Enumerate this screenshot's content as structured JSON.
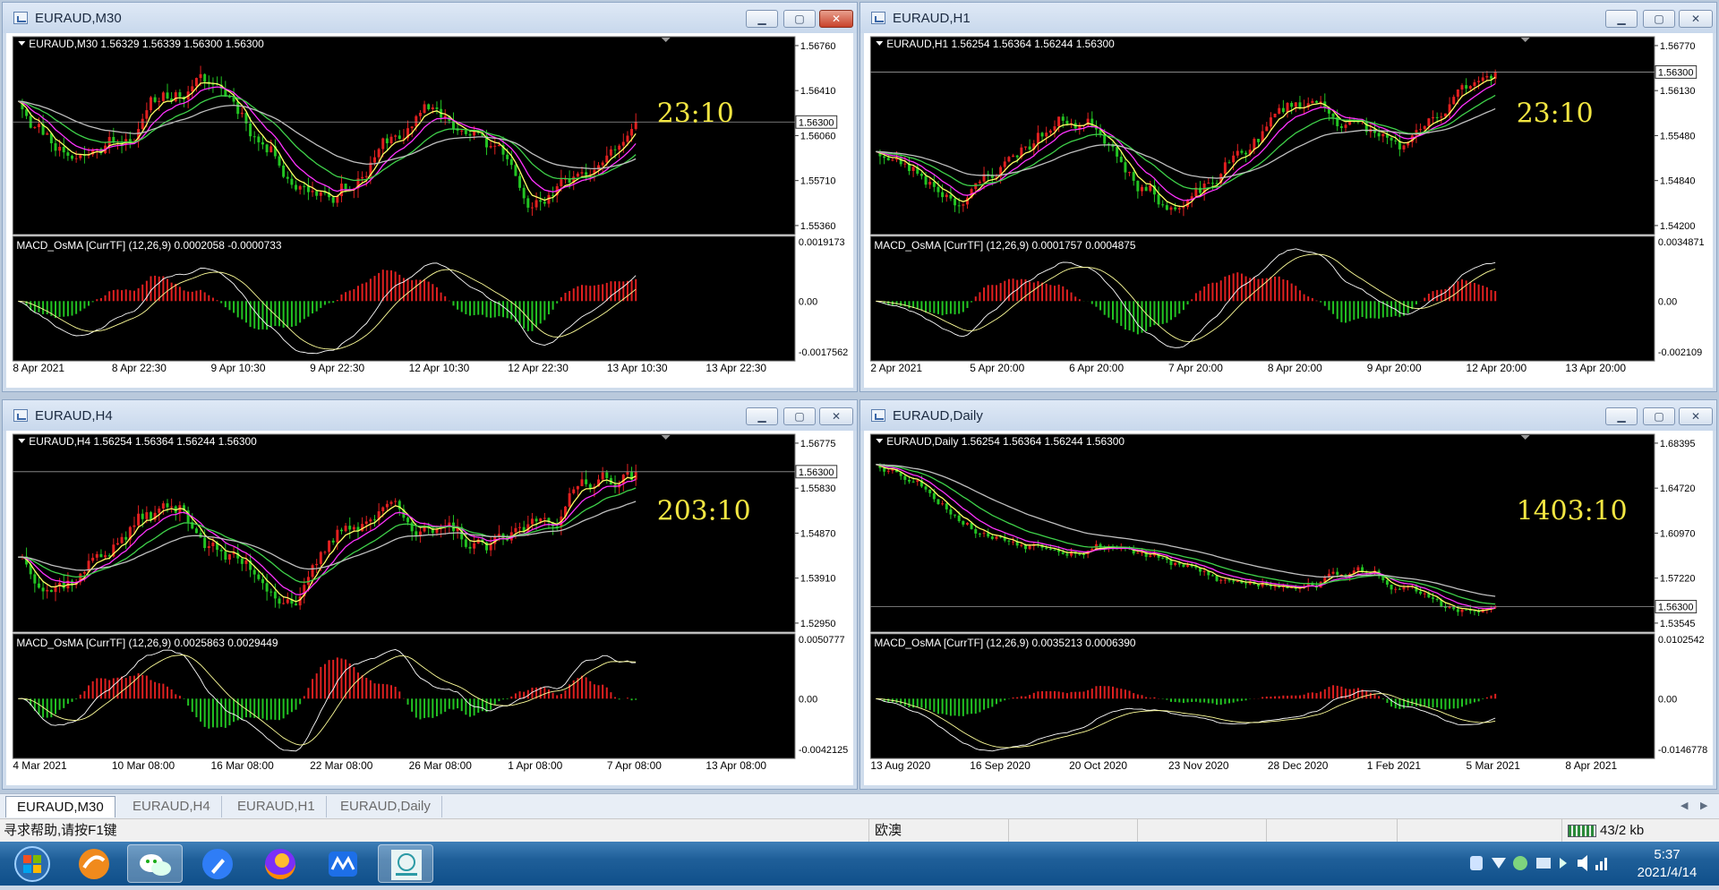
{
  "colors": {
    "bull": "#e12020",
    "bear": "#22c422",
    "price_box": "#ffffff",
    "countdown": "#f2e642",
    "ema_fast": "#ffff66",
    "ema_mid": "#ff33ff",
    "ema_slow": "#3fd24a",
    "ema_long": "#c0c0c0",
    "macd_line": "#ffffff",
    "signal_line": "#ffff99"
  },
  "windows": [
    {
      "title": "EURAUD,M30",
      "header": "EURAUD,M30  1.56329 1.56339 1.56300 1.56300",
      "price_labels": [
        "1.56760",
        "1.56410",
        "1.56060",
        "1.55710",
        "1.55360"
      ],
      "current_price": "1.56300",
      "countdown": "23:10",
      "indicator_header": "MACD_OsMA [CurrTF] (12,26,9) 0.0002058 -0.0000733",
      "indicator_labels": [
        "0.0019173",
        "0.00",
        "-0.0017562"
      ],
      "time_labels": [
        "8 Apr 2021",
        "8 Apr 22:30",
        "9 Apr 10:30",
        "9 Apr 22:30",
        "12 Apr 10:30",
        "12 Apr 22:30",
        "13 Apr 10:30",
        "13 Apr 22:30"
      ]
    },
    {
      "title": "EURAUD,H1",
      "header": "EURAUD,H1  1.56254 1.56364 1.56244 1.56300",
      "price_labels": [
        "1.56770",
        "1.56130",
        "1.55480",
        "1.54840",
        "1.54200"
      ],
      "current_price": "1.56300",
      "countdown": "23:10",
      "indicator_header": "MACD_OsMA [CurrTF] (12,26,9) 0.0001757 0.0004875",
      "indicator_labels": [
        "0.0034871",
        "0.00",
        "-0.002109"
      ],
      "time_labels": [
        "2 Apr 2021",
        "5 Apr 20:00",
        "6 Apr 20:00",
        "7 Apr 20:00",
        "8 Apr 20:00",
        "9 Apr 20:00",
        "12 Apr 20:00",
        "13 Apr 20:00"
      ]
    },
    {
      "title": "EURAUD,H4",
      "header": "EURAUD,H4  1.56254 1.56364 1.56244 1.56300",
      "price_labels": [
        "1.56775",
        "1.55830",
        "1.54870",
        "1.53910",
        "1.52950"
      ],
      "current_price": "1.56300",
      "countdown": "203:10",
      "indicator_header": "MACD_OsMA [CurrTF] (12,26,9) 0.0025863 0.0029449",
      "indicator_labels": [
        "0.0050777",
        "0.00",
        "-0.0042125"
      ],
      "time_labels": [
        "4 Mar 2021",
        "10 Mar 08:00",
        "16 Mar 08:00",
        "22 Mar 08:00",
        "26 Mar 08:00",
        "1 Apr 08:00",
        "7 Apr 08:00",
        "13 Apr 08:00"
      ]
    },
    {
      "title": "EURAUD,Daily",
      "header": "EURAUD,Daily  1.56254 1.56364 1.56244 1.56300",
      "price_labels": [
        "1.68395",
        "1.64720",
        "1.60970",
        "1.57220",
        "1.53545"
      ],
      "current_price": "1.56300",
      "countdown": "1403:10",
      "indicator_header": "MACD_OsMA [CurrTF] (12,26,9) 0.0035213 0.0006390",
      "indicator_labels": [
        "0.0102542",
        "0.00",
        "-0.0146778"
      ],
      "time_labels": [
        "13 Aug 2020",
        "16 Sep 2020",
        "20 Oct 2020",
        "23 Nov 2020",
        "28 Dec 2020",
        "1 Feb 2021",
        "5 Mar 2021",
        "8 Apr 2021"
      ]
    }
  ],
  "tabs": [
    "EURAUD,M30",
    "EURAUD,H4",
    "EURAUD,H1",
    "EURAUD,Daily"
  ],
  "status": {
    "help": "寻求帮助,请按F1键",
    "profile": "欧澳",
    "traffic": "43/2 kb"
  },
  "taskbar": {
    "apps": [
      "start-orb-icon",
      "browser-orange-icon",
      "wechat-icon",
      "notes-icon",
      "firefox-icon",
      "meeting-icon",
      "trading-terminal-icon"
    ]
  },
  "clock": {
    "time": "5:37",
    "date": "2021/4/14"
  }
}
